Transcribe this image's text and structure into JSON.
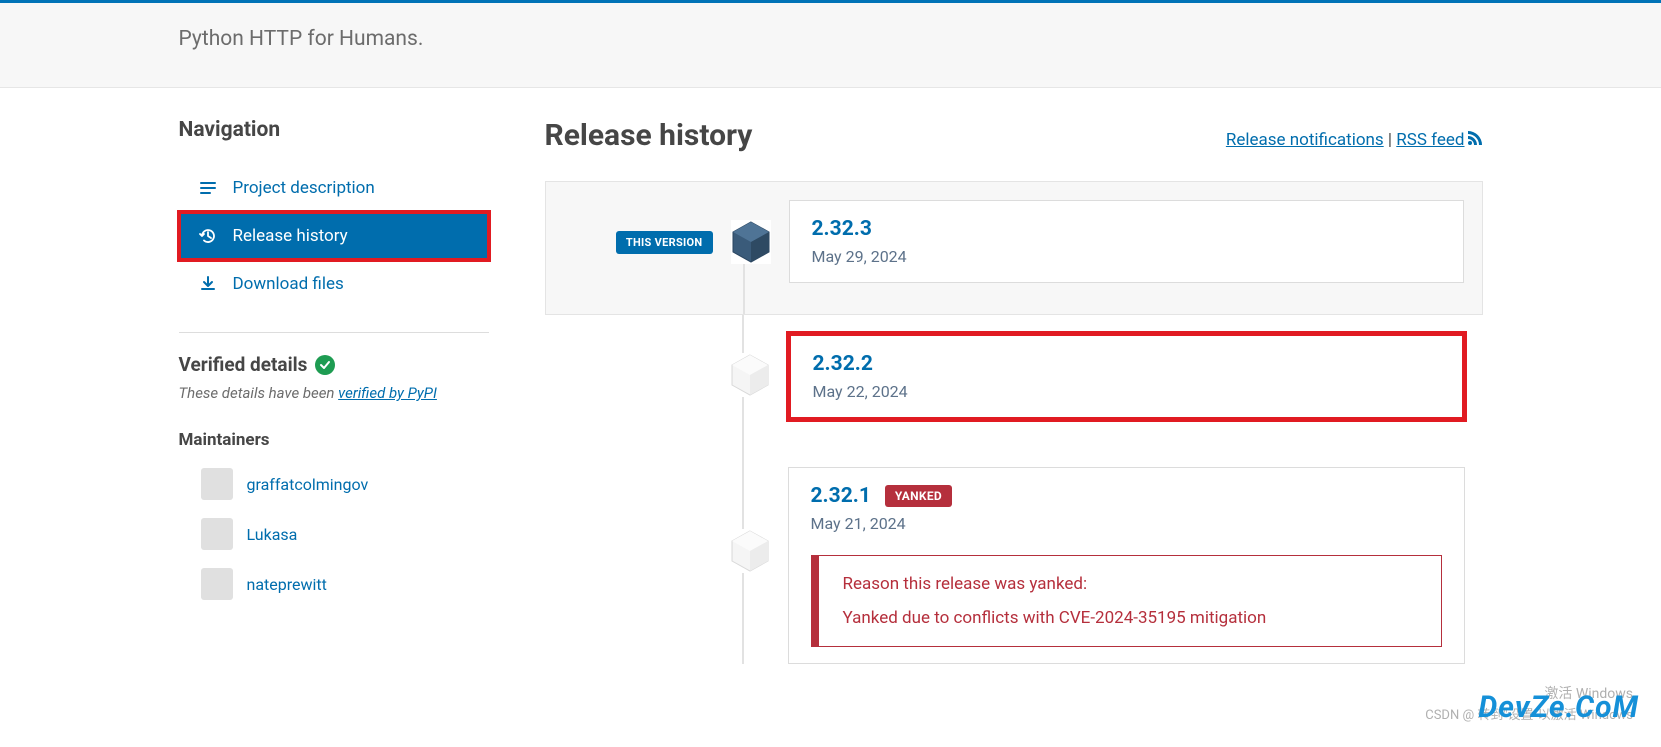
{
  "header": {
    "summary": "Python HTTP for Humans."
  },
  "nav": {
    "heading": "Navigation",
    "items": [
      {
        "label": "Project description"
      },
      {
        "label": "Release history"
      },
      {
        "label": "Download files"
      }
    ]
  },
  "verified": {
    "heading": "Verified details",
    "sub_prefix": "These details have been ",
    "sub_link": "verified by PyPI"
  },
  "maintainers": {
    "heading": "Maintainers",
    "list": [
      {
        "name": "graffatcolmingov"
      },
      {
        "name": "Lukasa"
      },
      {
        "name": "nateprewitt"
      }
    ]
  },
  "main": {
    "title": "Release history",
    "notifications": "Release notifications",
    "sep": " | ",
    "rss": "RSS feed"
  },
  "releases": [
    {
      "version": "2.32.3",
      "date": "May 29, 2024",
      "this_version_label": "THIS VERSION",
      "current": true
    },
    {
      "version": "2.32.2",
      "date": "May 22, 2024",
      "highlight": true
    },
    {
      "version": "2.32.1",
      "date": "May 21, 2024",
      "yanked_label": "YANKED",
      "yank_title": "Reason this release was yanked:",
      "yank_reason": "Yanked due to conflicts with CVE-2024-35195 mitigation"
    }
  ],
  "watermarks": {
    "line1": "激活 Windows",
    "line2": "CSDN @ 转到\"设置\"以激活 Windows",
    "logo": "DevZe.CoM"
  }
}
